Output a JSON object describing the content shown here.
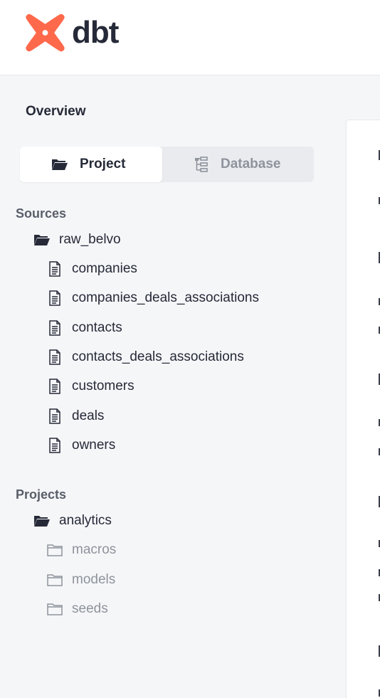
{
  "brand": {
    "name": "dbt",
    "color": "#ff694b"
  },
  "sidebar": {
    "title": "Overview",
    "tabs": [
      {
        "label": "Project",
        "icon": "folder-open-icon",
        "active": true
      },
      {
        "label": "Database",
        "icon": "tree-icon",
        "active": false
      }
    ],
    "sources": {
      "title": "Sources",
      "folder": {
        "label": "raw_belvo",
        "icon": "folder-open-icon"
      },
      "items": [
        {
          "label": "companies",
          "icon": "document-icon"
        },
        {
          "label": "companies_deals_associations",
          "icon": "document-icon"
        },
        {
          "label": "contacts",
          "icon": "document-icon"
        },
        {
          "label": "contacts_deals_associations",
          "icon": "document-icon"
        },
        {
          "label": "customers",
          "icon": "document-icon"
        },
        {
          "label": "deals",
          "icon": "document-icon"
        },
        {
          "label": "owners",
          "icon": "document-icon"
        }
      ]
    },
    "projects": {
      "title": "Projects",
      "folder": {
        "label": "analytics",
        "icon": "folder-open-icon"
      },
      "items": [
        {
          "label": "macros",
          "icon": "folder-icon"
        },
        {
          "label": "models",
          "icon": "folder-icon"
        },
        {
          "label": "seeds",
          "icon": "folder-icon"
        }
      ]
    }
  },
  "colors": {
    "text": "#262a38",
    "muted": "#8e939c",
    "section": "#595e69",
    "background": "#f5f6f8"
  }
}
